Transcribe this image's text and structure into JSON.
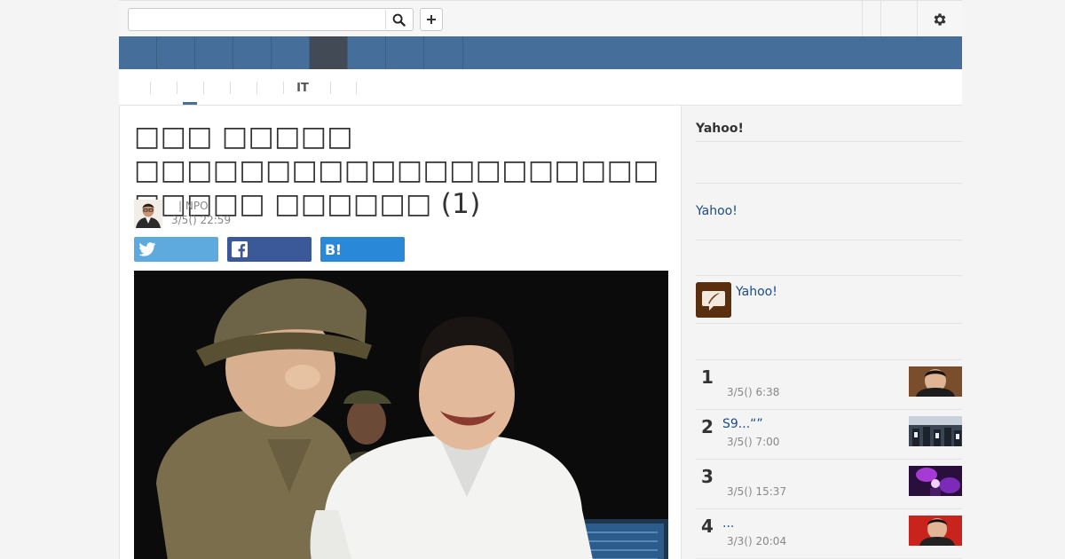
{
  "search": {
    "value": "",
    "placeholder": "",
    "icon": "search-icon"
  },
  "toolbar": {
    "add_icon": "plus-icon",
    "settings_icon": "gear-icon"
  },
  "nav": {
    "tabs": [
      {
        "label": ""
      },
      {
        "label": ""
      },
      {
        "label": ""
      },
      {
        "label": ""
      },
      {
        "label": ""
      },
      {
        "label": "",
        "active": true
      },
      {
        "label": ""
      },
      {
        "label": ""
      },
      {
        "label": ""
      }
    ],
    "active_color": "#424a55",
    "bar_color": "#456e9a"
  },
  "subnav": {
    "items": [
      {
        "label": ""
      },
      {
        "label": ""
      },
      {
        "label": "",
        "active": true
      },
      {
        "label": ""
      },
      {
        "label": ""
      },
      {
        "label": ""
      },
      {
        "label": "IT"
      },
      {
        "label": ""
      },
      {
        "label": ""
      }
    ]
  },
  "article": {
    "title": "□□□ □□□□□ □□□□□□□□□□□□□□□□□□□□ □□□□□ □□□□□□ (1)",
    "author": "",
    "publisher": "| NPO",
    "date": "3/5() 22:59",
    "share": {
      "twitter_icon": "twitter-icon",
      "facebook_icon": "facebook-icon",
      "hatena_label": "B!"
    }
  },
  "sidebar": {
    "heading": "Yahoo!",
    "link1": "Yahoo!",
    "app_link": "Yahoo!",
    "app_icon": "quill-speech-icon",
    "ranking": [
      {
        "rank": "1",
        "title": "",
        "time": "3/5() 6:38"
      },
      {
        "rank": "2",
        "title": "S9...“”",
        "time": "3/5() 7:00"
      },
      {
        "rank": "3",
        "title": "",
        "time": "3/5() 15:37"
      },
      {
        "rank": "4",
        "title": "...",
        "time": "3/3() 20:04"
      }
    ]
  }
}
